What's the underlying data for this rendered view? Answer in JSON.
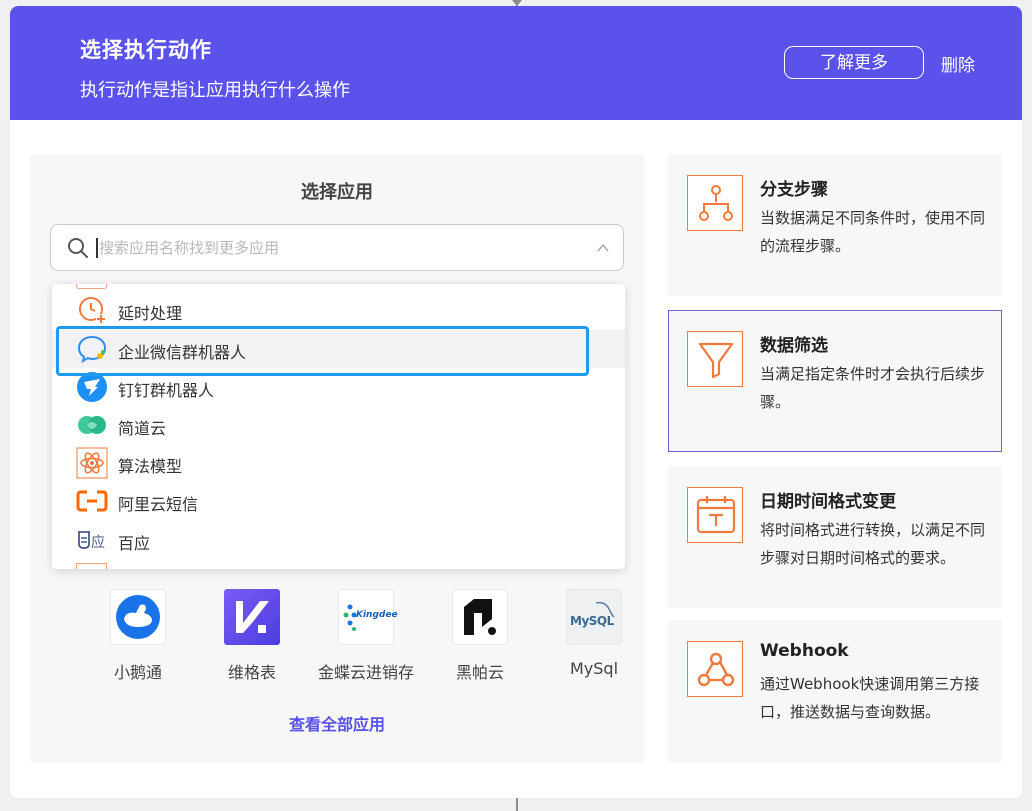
{
  "header": {
    "title": "选择执行动作",
    "subtitle": "执行动作是指让应用执行什么操作",
    "learn_more": "了解更多",
    "delete": "删除"
  },
  "select_app": {
    "title": "选择应用",
    "search_placeholder": "搜索应用名称找到更多应用",
    "search_value": ""
  },
  "dropdown": {
    "items": [
      {
        "label": "延时处理",
        "icon": "clock-plus-icon"
      },
      {
        "label": "企业微信群机器人",
        "icon": "wecom-bot-icon",
        "highlighted": true
      },
      {
        "label": "钉钉群机器人",
        "icon": "dingtalk-icon"
      },
      {
        "label": "简道云",
        "icon": "jiandaoyun-icon"
      },
      {
        "label": "算法模型",
        "icon": "atom-icon"
      },
      {
        "label": "阿里云短信",
        "icon": "aliyun-icon"
      },
      {
        "label": "百应",
        "icon": "baiying-icon"
      }
    ]
  },
  "apps": [
    {
      "name": "小鹅通",
      "icon": "xiaoetong-icon"
    },
    {
      "name": "维格表",
      "icon": "vika-icon"
    },
    {
      "name": "金蝶云进销存",
      "icon": "kingdee-icon",
      "logo_text": "Kingdee"
    },
    {
      "name": "黑帕云",
      "icon": "heipayun-icon"
    },
    {
      "name": "MySql",
      "icon": "mysql-icon",
      "logo_text": "MySQL"
    }
  ],
  "see_all": "查看全部应用",
  "steps": [
    {
      "title": "分支步骤",
      "desc": "当数据满足不同条件时，使用不同的流程步骤。",
      "icon": "branch-icon"
    },
    {
      "title": "数据筛选",
      "desc": "当满足指定条件时才会执行后续步骤。",
      "icon": "filter-icon",
      "selected": true
    },
    {
      "title": "日期时间格式变更",
      "desc": "将时间格式进行转换，以满足不同步骤对日期时间格式的要求。",
      "icon": "calendar-icon"
    },
    {
      "title": "Webhook",
      "desc": "通过Webhook快速调用第三方接口，推送数据与查询数据。",
      "icon": "webhook-icon"
    }
  ],
  "colors": {
    "header_bg": "#5a52ea",
    "accent": "#5a52ea",
    "highlight_border": "#1e9bf0",
    "step_icon": "#f07a3c"
  }
}
